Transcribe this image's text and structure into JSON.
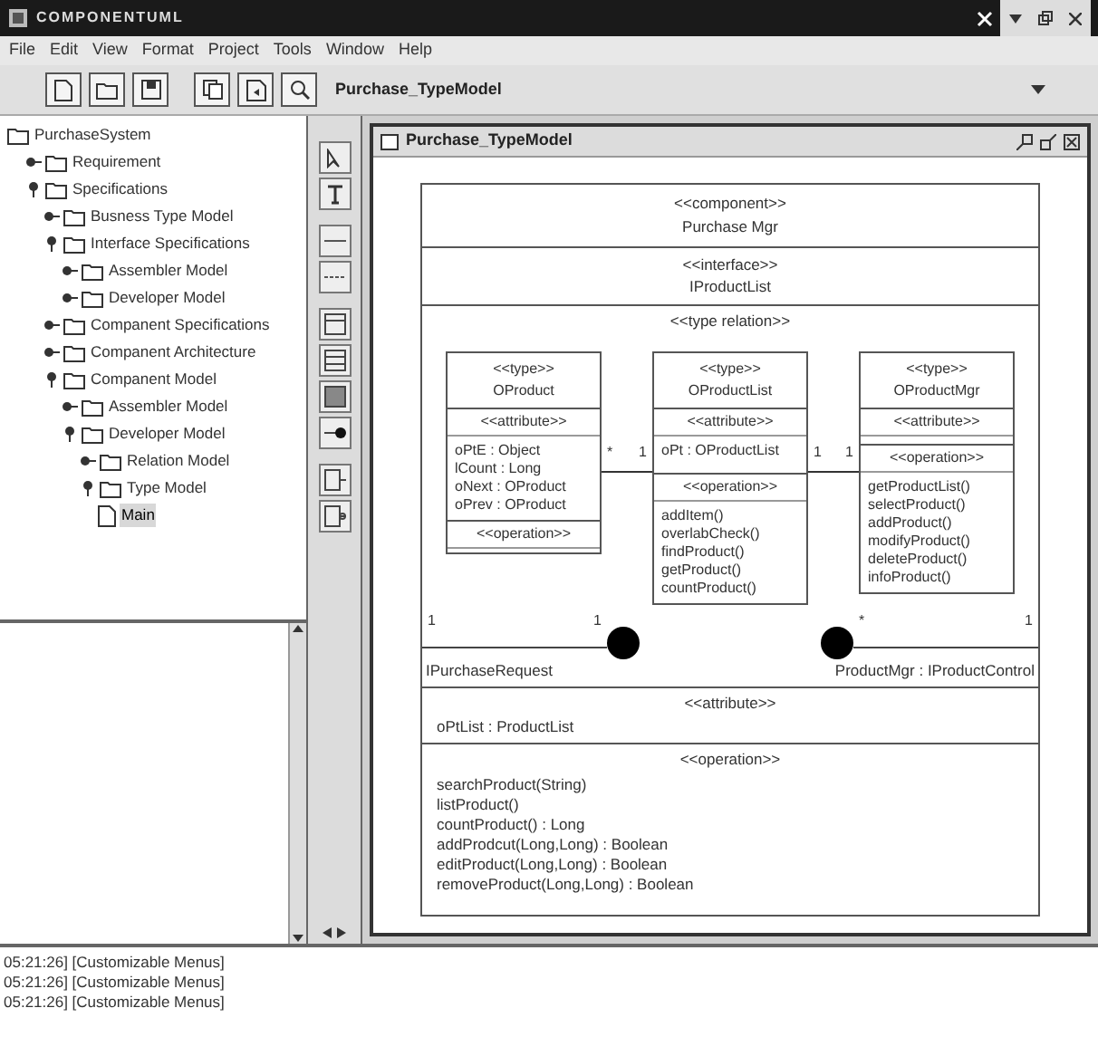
{
  "window": {
    "title": "COMPONENTUML"
  },
  "menu": [
    "File",
    "Edit",
    "View",
    "Format",
    "Project",
    "Tools",
    "Window",
    "Help"
  ],
  "toolbar": {
    "model_select": "Purchase_TypeModel"
  },
  "tree": [
    {
      "label": "PurchaseSystem",
      "kind": "folder",
      "selected": false,
      "children": [
        {
          "label": "Requirement",
          "kind": "folder",
          "expanded": false,
          "selected": false
        },
        {
          "label": "Specifications",
          "kind": "folder",
          "expanded": true,
          "selected": false,
          "children": [
            {
              "label": "Busness Type Model",
              "kind": "folder",
              "expanded": false,
              "selected": false
            },
            {
              "label": "Interface Specifications",
              "kind": "folder",
              "expanded": true,
              "selected": false,
              "children": [
                {
                  "label": "Assembler Model",
                  "kind": "folder",
                  "expanded": false,
                  "selected": false
                },
                {
                  "label": "Developer Model",
                  "kind": "folder",
                  "expanded": false,
                  "selected": false
                }
              ]
            },
            {
              "label": "Companent Specifications",
              "kind": "folder",
              "expanded": false,
              "selected": false
            },
            {
              "label": "Companent Architecture",
              "kind": "folder",
              "expanded": false,
              "selected": false
            },
            {
              "label": "Companent Model",
              "kind": "folder",
              "expanded": true,
              "selected": false,
              "children": [
                {
                  "label": "Assembler Model",
                  "kind": "folder",
                  "expanded": false,
                  "selected": false
                },
                {
                  "label": "Developer Model",
                  "kind": "folder",
                  "expanded": true,
                  "selected": false,
                  "children": [
                    {
                      "label": "Relation Model",
                      "kind": "folder",
                      "expanded": false,
                      "selected": false
                    },
                    {
                      "label": "Type Model",
                      "kind": "folder",
                      "expanded": true,
                      "selected": false,
                      "children": [
                        {
                          "label": "Main",
                          "kind": "diagram",
                          "selected": true
                        }
                      ]
                    }
                  ]
                }
              ]
            }
          ]
        }
      ]
    }
  ],
  "diagram": {
    "title": "Purchase_TypeModel",
    "component": {
      "stereotype": "<<component>>",
      "name": "Purchase Mgr"
    },
    "interface": {
      "stereotype": "<<interface>>",
      "name": "IProductList"
    },
    "relation_label": "<<type relation>>",
    "types": [
      {
        "stereotype": "<<type>>",
        "name": "OProduct",
        "sections": [
          {
            "label": "<<attribute>>",
            "items": [
              "oPtE : Object",
              "lCount : Long",
              "oNext : OProduct",
              "oPrev : OProduct"
            ]
          },
          {
            "label": "<<operation>>"
          }
        ]
      },
      {
        "stereotype": "<<type>>",
        "name": "OProductList",
        "sections": [
          {
            "label": "<<attribute>>",
            "items": [
              "oPt : OProductList"
            ]
          },
          {
            "label": "<<operation>>",
            "items": [
              "addItem()",
              "overlabCheck()",
              "findProduct()",
              "getProduct()",
              "countProduct()"
            ]
          }
        ]
      },
      {
        "stereotype": "<<type>>",
        "name": "OProductMgr",
        "sections": [
          {
            "label": "<<attribute>>"
          },
          {
            "label": "<<operation>>",
            "items": [
              "getProductList()",
              "selectProduct()",
              "addProduct()",
              "modifyProduct()",
              "deleteProduct()",
              "infoProduct()"
            ]
          }
        ]
      }
    ],
    "associations": [
      {
        "from_end": "*",
        "to_end": "1"
      },
      {
        "from_end": "1",
        "to_end": "1"
      }
    ],
    "ports": [
      {
        "name": "IPurchaseRequest",
        "ends": [
          "1",
          "1"
        ]
      },
      {
        "name": "ProductMgr : IProductControl",
        "ends": [
          "*",
          "1"
        ]
      }
    ],
    "attributes": {
      "label": "<<attribute>>",
      "items": [
        "oPtList : ProductList"
      ]
    },
    "operations": {
      "label": "<<operation>>",
      "items": [
        "searchProduct(String)",
        "listProduct()",
        "countProduct() : Long",
        "addProdcut(Long,Long) : Boolean",
        "editProduct(Long,Long) : Boolean",
        "removeProduct(Long,Long) : Boolean"
      ]
    }
  },
  "log": [
    "05:21:26] [Customizable Menus]",
    "05:21:26] [Customizable Menus]",
    "05:21:26] [Customizable Menus]"
  ]
}
